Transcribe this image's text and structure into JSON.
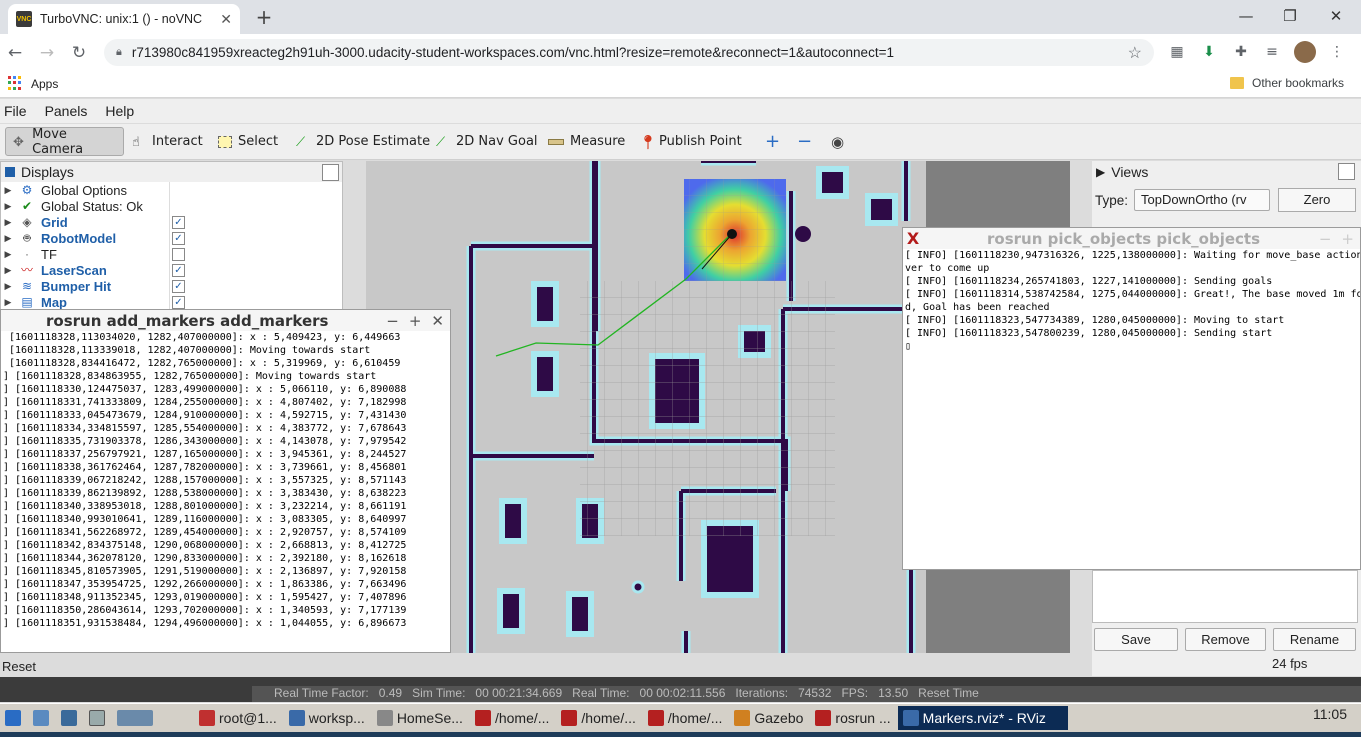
{
  "browser": {
    "tab_title": "TurboVNC: unix:1 () - noVNC",
    "favicon_text": "VNC",
    "new_tab": "+",
    "url": "r713980c841959xreacteg2h91uh-3000.udacity-student-workspaces.com/vnc.html?resize=remote&reconnect=1&autoconnect=1",
    "bookmarks": {
      "apps": "Apps",
      "other": "Other bookmarks"
    }
  },
  "rviz": {
    "menu": [
      "File",
      "Panels",
      "Help"
    ],
    "tools": [
      "Move Camera",
      "Interact",
      "Select",
      "2D Pose Estimate",
      "2D Nav Goal",
      "Measure",
      "Publish Point"
    ],
    "displays": {
      "title": "Displays",
      "items": [
        {
          "label": "Global Options",
          "checked": null,
          "style": "plain"
        },
        {
          "label": "Global Status: Ok",
          "checked": null,
          "style": "plain"
        },
        {
          "label": "Grid",
          "checked": true,
          "style": "blue"
        },
        {
          "label": "RobotModel",
          "checked": true,
          "style": "blue"
        },
        {
          "label": "TF",
          "checked": false,
          "style": "plain"
        },
        {
          "label": "LaserScan",
          "checked": true,
          "style": "blue"
        },
        {
          "label": "Bumper Hit",
          "checked": true,
          "style": "blue"
        },
        {
          "label": "Map",
          "checked": true,
          "style": "blue"
        }
      ]
    },
    "views": {
      "title": "Views",
      "type_label": "Type:",
      "type_value": "TopDownOrtho (rv",
      "zero": "Zero",
      "save": "Save",
      "remove": "Remove",
      "rename": "Rename"
    },
    "fps": "24 fps",
    "reset": "Reset"
  },
  "gazebo_bar": {
    "real_time_factor_label": "Real Time Factor:",
    "real_time_factor": "0.49",
    "sim_time_label": "Sim Time:",
    "sim_time": "00 00:21:34.669",
    "real_time_label": "Real Time:",
    "real_time": "00 00:02:11.556",
    "iterations_label": "Iterations:",
    "iterations": "74532",
    "fps_label": "FPS:",
    "fps": "13.50",
    "reset_time": "Reset Time"
  },
  "terminal_add_markers": {
    "title": "rosrun add_markers add_markers",
    "lines": [
      " [1601118328,113034020, 1282,407000000]: x : 5,409423, y: 6,449663",
      " [1601118328,113339018, 1282,407000000]: Moving towards start",
      " [1601118328,834416472, 1282,765000000]: x : 5,319969, y: 6,610459",
      "] [1601118328,834863955, 1282,765000000]: Moving towards start",
      "] [1601118330,124475037, 1283,499000000]: x : 5,066110, y: 6,890088",
      "] [1601118331,741333809, 1284,255000000]: x : 4,807402, y: 7,182998",
      "] [1601118333,045473679, 1284,910000000]: x : 4,592715, y: 7,431430",
      "] [1601118334,334815597, 1285,554000000]: x : 4,383772, y: 7,678643",
      "] [1601118335,731903378, 1286,343000000]: x : 4,143078, y: 7,979542",
      "] [1601118337,256797921, 1287,165000000]: x : 3,945361, y: 8,244527",
      "] [1601118338,361762464, 1287,782000000]: x : 3,739661, y: 8,456801",
      "] [1601118339,067218242, 1288,157000000]: x : 3,557325, y: 8,571143",
      "] [1601118339,862139892, 1288,538000000]: x : 3,383430, y: 8,638223",
      "] [1601118340,338953018, 1288,801000000]: x : 3,232214, y: 8,661191",
      "] [1601118340,993010641, 1289,116000000]: x : 3,083305, y: 8,640997",
      "] [1601118341,562268972, 1289,454000000]: x : 2,920757, y: 8,574109",
      "] [1601118342,834375148, 1290,068000000]: x : 2,668813, y: 8,412725",
      "] [1601118344,362078120, 1290,833000000]: x : 2,392180, y: 8,162618",
      "] [1601118345,810573905, 1291,519000000]: x : 2,136897, y: 7,920158",
      "] [1601118347,353954725, 1292,266000000]: x : 1,863386, y: 7,663496",
      "] [1601118348,911352345, 1293,019000000]: x : 1,595427, y: 7,407896",
      "] [1601118350,286043614, 1293,702000000]: x : 1,340593, y: 7,177139",
      "] [1601118351,931538484, 1294,496000000]: x : 1,044055, y: 6,896673"
    ]
  },
  "terminal_pick_objects": {
    "title": "rosrun pick_objects pick_objects",
    "lines": [
      "[ INFO] [1601118230,947316326, 1225,138000000]: Waiting for move_base action",
      "ver to come up",
      "[ INFO] [1601118234,265741803, 1227,141000000]: Sending goals",
      "[ INFO] [1601118314,538742584, 1275,044000000]: Great!, The base moved 1m fo",
      "d, Goal has been reached",
      "[ INFO] [1601118323,547734389, 1280,045000000]: Moving to start",
      "[ INFO] [1601118323,547800239, 1280,045000000]: Sending start",
      "▯"
    ]
  },
  "taskbar": {
    "items": [
      "root@1...",
      "worksp...",
      "HomeSe...",
      "/home/...",
      "/home/...",
      "/home/...",
      "Gazebo",
      "rosrun ...",
      "Markers.rviz* - RViz"
    ],
    "clock": "11:05"
  },
  "colors": {
    "map_free": "#c8c8c8",
    "map_unknown": "#7f7f7f",
    "map_wall": "#2e0a46",
    "inflation": "#a8e8f0",
    "path_green": "#22b522",
    "taskbar_active": "#0c2b54"
  }
}
